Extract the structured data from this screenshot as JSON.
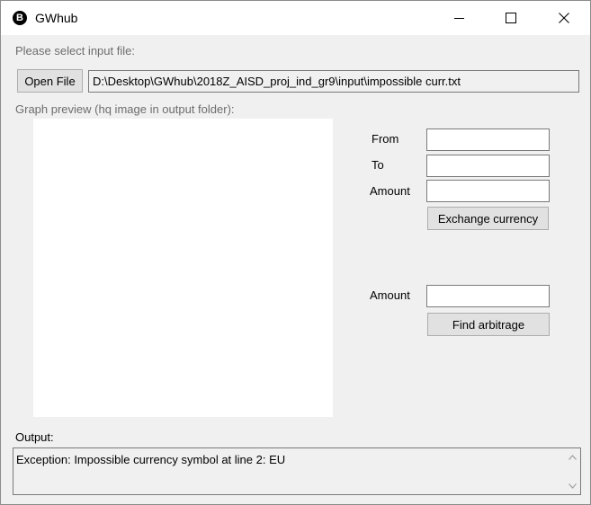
{
  "window": {
    "title": "GWhub",
    "app_icon_glyph": "B",
    "controls": {
      "minimize": "minimize-icon",
      "maximize": "maximize-icon",
      "close": "close-icon"
    }
  },
  "input": {
    "select_label": "Please select input file:",
    "open_button": "Open File",
    "file_path": "D:\\Desktop\\GWhub\\2018Z_AISD_proj_ind_gr9\\input\\impossible curr.txt"
  },
  "preview": {
    "label": "Graph preview (hq image in output folder):"
  },
  "exchange": {
    "from_label": "From",
    "to_label": "To",
    "amount_label": "Amount",
    "from_value": "",
    "to_value": "",
    "amount_value": "",
    "button": "Exchange currency"
  },
  "arbitrage": {
    "amount_label": "Amount",
    "amount_value": "",
    "button": "Find arbitrage"
  },
  "output": {
    "label": "Output:",
    "text": "Exception: Impossible currency symbol at line 2: EU"
  }
}
